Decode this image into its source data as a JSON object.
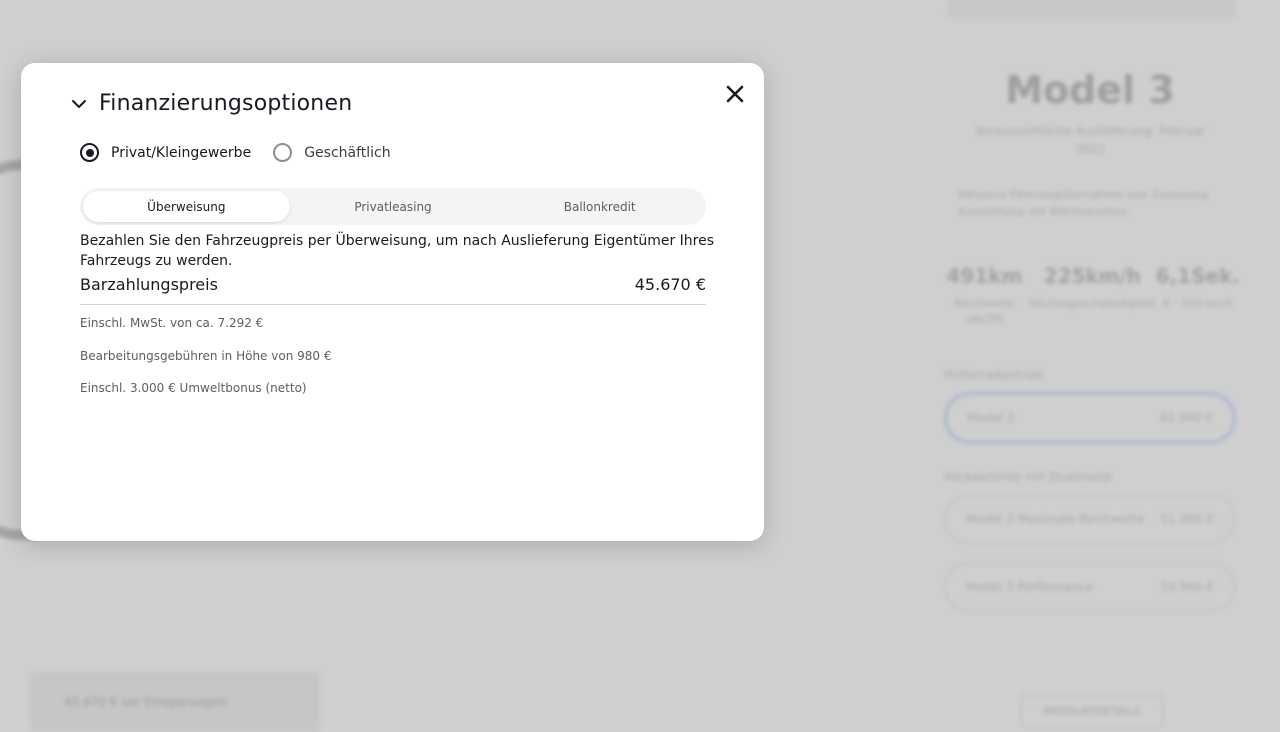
{
  "background": {
    "model_title": "Model 3",
    "model_sub": "Voraussichtliche Auslieferung: Februar 2022",
    "model_desc": "Inklusive Fahrzeugübernahme und Zulassung. Ausstattung mit Wärmepumpe.",
    "specs": [
      {
        "value": "491km",
        "label": "Reichweite (WLTP)"
      },
      {
        "value": "225km/h",
        "label": "Höchstgeschwindigkeit"
      },
      {
        "value": "6,1Sek.",
        "label": "0 - 100 km/h"
      }
    ],
    "section1": "Hinterradantrieb",
    "option_selected": {
      "name": "Model 3",
      "price": "42.990 €"
    },
    "section2": "Allradantrieb mit Dualmotor",
    "options": [
      {
        "name": "Model 3 Maximale Reichweite",
        "price": "51.990 €"
      },
      {
        "name": "Model 3 Performance",
        "price": "59.990 €"
      }
    ],
    "bottom_bar": "45.670 € vor Einsparungen",
    "details_button": "PRODUKTDETAILS"
  },
  "modal": {
    "title": "Finanzierungsoptionen",
    "radios": [
      {
        "label": "Privat/Kleingewerbe",
        "checked": true
      },
      {
        "label": "Geschäftlich",
        "checked": false
      }
    ],
    "tabs": [
      {
        "label": "Überweisung",
        "active": true
      },
      {
        "label": "Privatleasing",
        "active": false
      },
      {
        "label": "Ballonkredit",
        "active": false
      }
    ],
    "description": "Bezahlen Sie den Fahrzeugpreis per Überweisung, um nach Auslieferung Eigentümer Ihres Fahrzeugs zu werden.",
    "price_label": "Barzahlungspreis",
    "price_value": "45.670 €",
    "notes": [
      "Einschl. MwSt. von ca. 7.292 €",
      "Bearbeitungsgebühren in Höhe von 980 €",
      "Einschl. 3.000 € Umweltbonus (netto)"
    ]
  },
  "colors": {
    "overlay": "#cfcfcf",
    "text_primary": "#171a20",
    "text_secondary": "#5c5e62",
    "tab_track": "#f4f4f4"
  },
  "icons": {
    "chevron": "chevron-down-icon",
    "close": "close-icon"
  }
}
